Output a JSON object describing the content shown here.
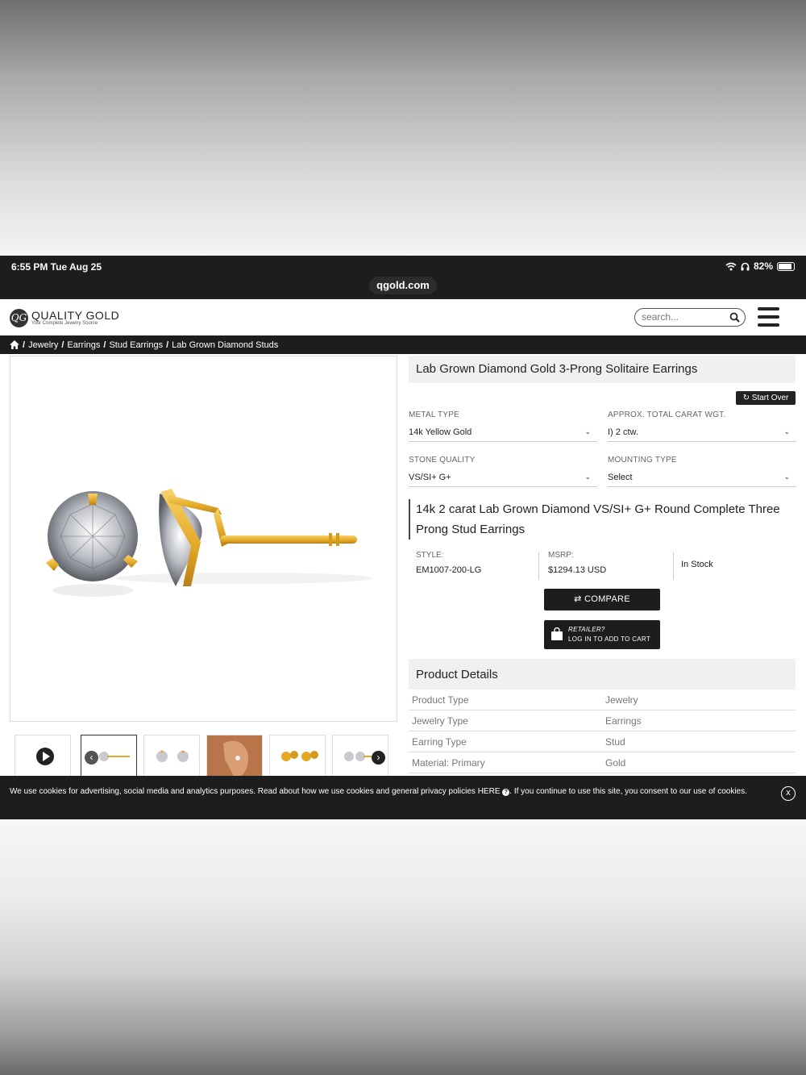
{
  "status_bar": {
    "time": "6:55 PM  Tue Aug 25",
    "battery": "82%",
    "battery_level": 0.82
  },
  "browser": {
    "url": "qgold.com"
  },
  "header": {
    "logo_name": "QUALITY GOLD",
    "logo_tagline": "Your Complete Jewelry Source",
    "logo_mark": "QG",
    "search_placeholder": "search..."
  },
  "breadcrumb": [
    "Jewelry",
    "Earrings",
    "Stud Earrings",
    "Lab Grown Diamond Studs"
  ],
  "product": {
    "title": "Lab Grown Diamond Gold 3-Prong Solitaire Earrings",
    "start_over": "Start Over",
    "options": {
      "metal_type": {
        "label": "METAL TYPE",
        "value": "14k Yellow Gold"
      },
      "carat": {
        "label": "APPROX. TOTAL CARAT WGT.",
        "value": "I) 2 ctw."
      },
      "stone_quality": {
        "label": "STONE QUALITY",
        "value": "VS/SI+ G+"
      },
      "mounting_type": {
        "label": "MOUNTING TYPE",
        "value": "Select"
      }
    },
    "variant_title": "14k 2 carat Lab Grown Diamond VS/SI+ G+ Round Complete Three Prong Stud Earrings",
    "style_label": "STYLE:",
    "style_value": "EM1007-200-LG",
    "msrp_label": "MSRP:",
    "msrp_value": "$1294.13 USD",
    "stock": "In Stock",
    "compare_label": "COMPARE",
    "cart_line1": "RETAILER?",
    "cart_line2": "LOG IN TO ADD TO CART"
  },
  "details": {
    "heading": "Product Details",
    "rows": [
      {
        "key": "Product Type",
        "value": "Jewelry"
      },
      {
        "key": "Jewelry Type",
        "value": "Earrings"
      },
      {
        "key": "Earring Type",
        "value": "Stud"
      },
      {
        "key": "Material: Primary",
        "value": "Gold"
      }
    ]
  },
  "cookie": {
    "text_before": "We use cookies for advertising, social media and analytics purposes. Read about how we use cookies and general privacy policies ",
    "link": "HERE",
    "text_after": ". If you continue to use this site, you consent to our use of cookies.",
    "close": "x"
  },
  "colors": {
    "dark": "#1d1d1f",
    "gold": "#e8b030",
    "panel": "#f0f0f0"
  }
}
